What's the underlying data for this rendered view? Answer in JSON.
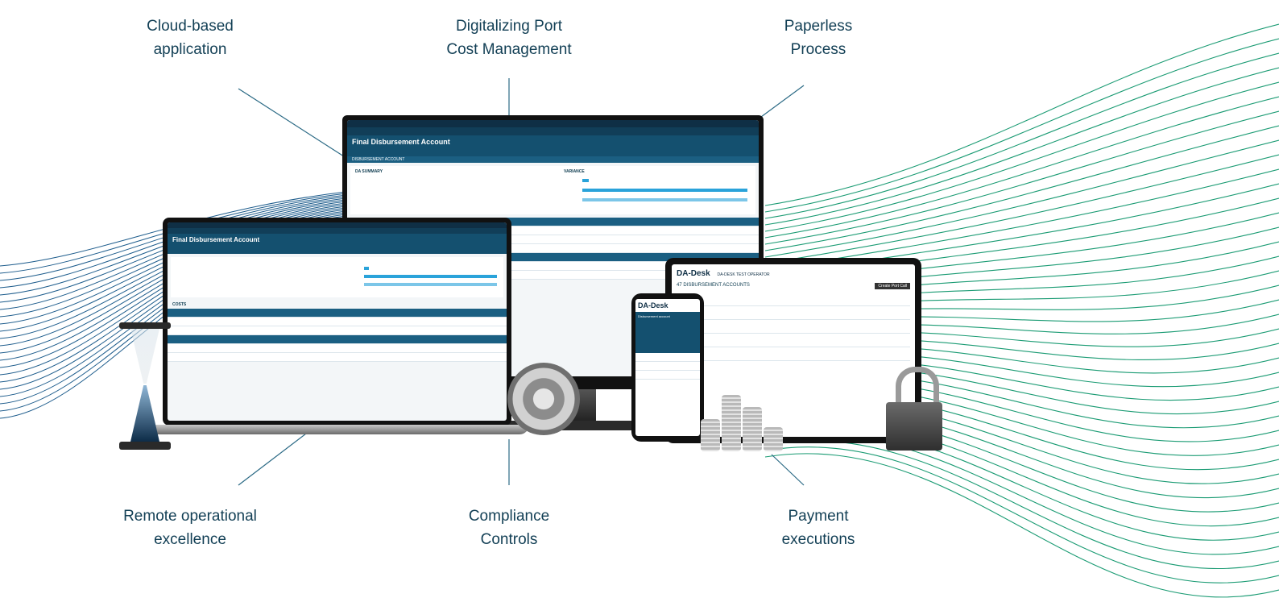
{
  "features": {
    "top_left": [
      "Cloud-based",
      "application"
    ],
    "top_center": [
      "Digitalizing Port",
      "Cost Management"
    ],
    "top_right": [
      "Paperless",
      "Process"
    ],
    "bottom_left": [
      "Remote operational",
      "excellence"
    ],
    "bottom_center": [
      "Compliance",
      "Controls"
    ],
    "bottom_right": [
      "Payment",
      "executions"
    ]
  },
  "monitor": {
    "title": "Final Disbursement Account",
    "tab": "DISBURSEMENT ACCOUNT",
    "summary": "DA SUMMARY",
    "variance": "VARIANCE"
  },
  "laptop": {
    "title": "Final Disbursement Account",
    "costs": "COSTS"
  },
  "tablet": {
    "brand": "DA-Desk",
    "operator": "DA-DESK TEST OPERATOR",
    "heading": "47 DISBURSEMENT ACCOUNTS",
    "button": "Create Port Call"
  },
  "phone": {
    "brand": "DA-Desk",
    "heading": "Disbursement account"
  },
  "colors": {
    "accent_green": "#1a9b73",
    "line_blue": "#1d5c8c",
    "text_dark": "#123f55"
  }
}
